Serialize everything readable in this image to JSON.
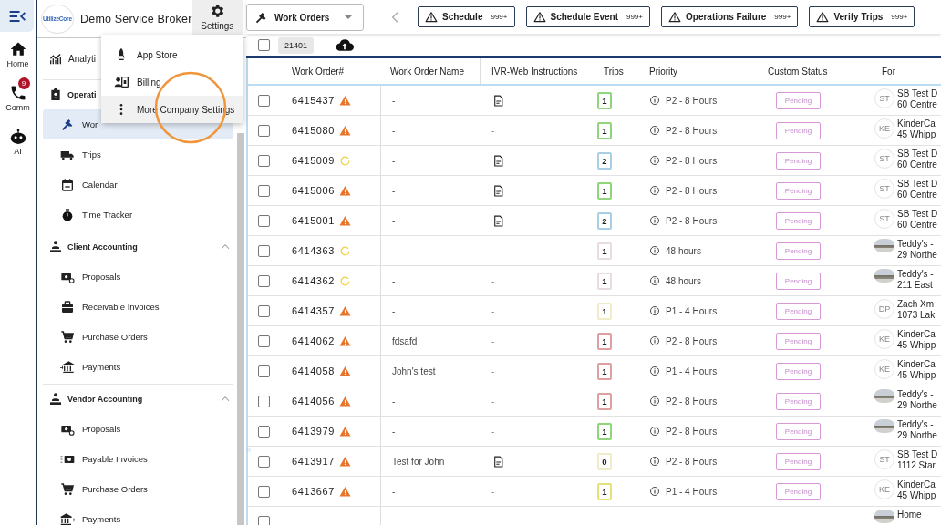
{
  "rail": {
    "items": [
      {
        "label": "Home"
      },
      {
        "label": "Comm",
        "badge": "9"
      },
      {
        "label": "AI"
      }
    ]
  },
  "header": {
    "logo_text": "UtilizeCore",
    "brand": "Demo Service Broker",
    "settings_label": "Settings"
  },
  "settings_menu": {
    "items": [
      {
        "label": "App Store",
        "selected": false
      },
      {
        "label": "Billing",
        "selected": false
      },
      {
        "label": "More Company Settings",
        "selected": true
      }
    ]
  },
  "sidebar": {
    "items": [
      {
        "kind": "link",
        "label": "Analyti"
      },
      {
        "kind": "section",
        "label": "Operati",
        "children": [
          {
            "label": "Wor",
            "selected": true
          },
          {
            "label": "Trips",
            "selected": false
          },
          {
            "label": "Calendar",
            "selected": false
          },
          {
            "label": "Time Tracker",
            "selected": false
          }
        ]
      },
      {
        "kind": "section",
        "label": "Client Accounting",
        "expanded": true,
        "children": [
          {
            "label": "Proposals",
            "selected": false
          },
          {
            "label": "Receivable Invoices",
            "selected": false
          },
          {
            "label": "Purchase Orders",
            "selected": false
          },
          {
            "label": "Payments",
            "selected": false
          }
        ]
      },
      {
        "kind": "section",
        "label": "Vendor Accounting",
        "expanded": true,
        "children": [
          {
            "label": "Proposals",
            "selected": false
          },
          {
            "label": "Payable Invoices",
            "selected": false
          },
          {
            "label": "Purchase Orders",
            "selected": false
          },
          {
            "label": "Payments",
            "selected": false
          }
        ]
      }
    ]
  },
  "topbar": {
    "view": "Work Orders",
    "alerts": [
      {
        "label": "Schedule",
        "count": "999+"
      },
      {
        "label": "Schedule Event",
        "count": "999+"
      },
      {
        "label": "Operations Failure",
        "count": "999+"
      },
      {
        "label": "Verify Trips",
        "count": "999+"
      }
    ]
  },
  "toolbar": {
    "checked": false,
    "total": "21401"
  },
  "table": {
    "columns": [
      "Work Order#",
      "Work Order Name",
      "IVR-Web Instructions",
      "Trips",
      "Priority",
      "Custom Status",
      "For"
    ],
    "rows": [
      {
        "selected": false,
        "number": "6415437",
        "status": {
          "kind": "warning"
        },
        "name": "-",
        "instructions": {
          "kind": "document"
        },
        "trips": {
          "text": "1",
          "color": "#8fd67a"
        },
        "priority": "P2 - 8 Hours",
        "custom_status": "Pending",
        "for_avatar": {
          "kind": "initials",
          "text": "ST"
        },
        "for_name": "SB Test D",
        "for_address": "60 Centre"
      },
      {
        "selected": false,
        "number": "6415080",
        "status": {
          "kind": "warning"
        },
        "name": "-",
        "instructions": {
          "kind": "text",
          "text": "-"
        },
        "trips": {
          "text": "1",
          "color": "#8fd67a"
        },
        "priority": "P2 - 8 Hours",
        "custom_status": "Pending",
        "for_avatar": {
          "kind": "initials",
          "text": "KE"
        },
        "for_name": "KinderCa",
        "for_address": "45 Whipp"
      },
      {
        "selected": false,
        "number": "6415009",
        "status": {
          "kind": "pending"
        },
        "name": "-",
        "instructions": {
          "kind": "document"
        },
        "trips": {
          "text": "2",
          "color": "#a9cfe6"
        },
        "priority": "P2 - 8 Hours",
        "custom_status": "Pending",
        "for_avatar": {
          "kind": "initials",
          "text": "ST"
        },
        "for_name": "SB Test D",
        "for_address": "60 Centre"
      },
      {
        "selected": false,
        "number": "6415006",
        "status": {
          "kind": "warning"
        },
        "name": "-",
        "instructions": {
          "kind": "document"
        },
        "trips": {
          "text": "1",
          "color": "#8fd67a"
        },
        "priority": "P2 - 8 Hours",
        "custom_status": "Pending",
        "for_avatar": {
          "kind": "initials",
          "text": "ST"
        },
        "for_name": "SB Test D",
        "for_address": "60 Centre"
      },
      {
        "selected": false,
        "number": "6415001",
        "status": {
          "kind": "warning"
        },
        "name": "-",
        "instructions": {
          "kind": "document"
        },
        "trips": {
          "text": "2",
          "color": "#a9cfe6"
        },
        "priority": "P2 - 8 Hours",
        "custom_status": "Pending",
        "for_avatar": {
          "kind": "initials",
          "text": "ST"
        },
        "for_name": "SB Test D",
        "for_address": "60 Centre"
      },
      {
        "selected": false,
        "number": "6414363",
        "status": {
          "kind": "pending"
        },
        "name": "-",
        "instructions": {
          "kind": "text",
          "text": "-"
        },
        "trips": {
          "text": "1",
          "color": "#e8dcdc"
        },
        "priority": "48 hours",
        "custom_status": "Pending",
        "for_avatar": {
          "kind": "photo"
        },
        "for_name": "Teddy's -",
        "for_address": "29 Northe"
      },
      {
        "selected": false,
        "number": "6414362",
        "status": {
          "kind": "pending"
        },
        "name": "-",
        "instructions": {
          "kind": "text",
          "text": "-"
        },
        "trips": {
          "text": "1",
          "color": "#e8dcdc"
        },
        "priority": "48 hours",
        "custom_status": "Pending",
        "for_avatar": {
          "kind": "photo"
        },
        "for_name": "Teddy's -",
        "for_address": "211 East"
      },
      {
        "selected": false,
        "number": "6414357",
        "status": {
          "kind": "warning"
        },
        "name": "-",
        "instructions": {
          "kind": "text",
          "text": "-"
        },
        "trips": {
          "text": "1",
          "color": "#f0ecc8"
        },
        "priority": "P1 - 4 Hours",
        "custom_status": "Pending",
        "for_avatar": {
          "kind": "initials",
          "text": "DP"
        },
        "for_name": "Zach Xm",
        "for_address": "1073 Lak"
      },
      {
        "selected": false,
        "number": "6414062",
        "status": {
          "kind": "warning"
        },
        "name": "fdsafd",
        "instructions": {
          "kind": "text",
          "text": "-"
        },
        "trips": {
          "text": "1",
          "color": "#e0a0a0"
        },
        "priority": "P2 - 8 Hours",
        "custom_status": "Pending",
        "for_avatar": {
          "kind": "initials",
          "text": "KE"
        },
        "for_name": "KinderCa",
        "for_address": "45 Whipp"
      },
      {
        "selected": false,
        "number": "6414058",
        "status": {
          "kind": "warning"
        },
        "name": "John's test",
        "instructions": {
          "kind": "text",
          "text": "-"
        },
        "trips": {
          "text": "1",
          "color": "#e0a0a0"
        },
        "priority": "P1 - 4 Hours",
        "custom_status": "Pending",
        "for_avatar": {
          "kind": "initials",
          "text": "KE"
        },
        "for_name": "KinderCa",
        "for_address": "45 Whipp"
      },
      {
        "selected": false,
        "number": "6414056",
        "status": {
          "kind": "warning"
        },
        "name": "-",
        "instructions": {
          "kind": "text",
          "text": "-"
        },
        "trips": {
          "text": "1",
          "color": "#e0a0a0"
        },
        "priority": "P2 - 8 Hours",
        "custom_status": "Pending",
        "for_avatar": {
          "kind": "photo"
        },
        "for_name": "Teddy's -",
        "for_address": "29 Northe"
      },
      {
        "selected": false,
        "number": "6413979",
        "status": {
          "kind": "warning"
        },
        "name": "-",
        "instructions": {
          "kind": "text",
          "text": "-"
        },
        "trips": {
          "text": "1",
          "color": "#8fd67a"
        },
        "priority": "P2 - 8 Hours",
        "custom_status": "Pending",
        "for_avatar": {
          "kind": "photo"
        },
        "for_name": "Teddy's -",
        "for_address": "29 Northe"
      },
      {
        "selected": false,
        "number": "6413917",
        "status": {
          "kind": "warning"
        },
        "name": "Test for John",
        "instructions": {
          "kind": "document"
        },
        "trips": {
          "text": "0",
          "color": "#f0ecc8"
        },
        "priority": "P2 - 8 Hours",
        "custom_status": "Pending",
        "for_avatar": {
          "kind": "initials",
          "text": "ST"
        },
        "for_name": "SB Test D",
        "for_address": "1112 Star"
      },
      {
        "selected": false,
        "number": "6413667",
        "status": {
          "kind": "warning"
        },
        "name": "-",
        "instructions": {
          "kind": "text",
          "text": "-"
        },
        "trips": {
          "text": "1",
          "color": "#e6e07a"
        },
        "priority": "P1 - 4 Hours",
        "custom_status": "Pending",
        "for_avatar": {
          "kind": "initials",
          "text": "KE"
        },
        "for_name": "KinderCa",
        "for_address": "45 Whipp"
      },
      {
        "selected": false,
        "for_avatar": {
          "kind": "photo"
        },
        "for_name": "Home"
      }
    ]
  }
}
